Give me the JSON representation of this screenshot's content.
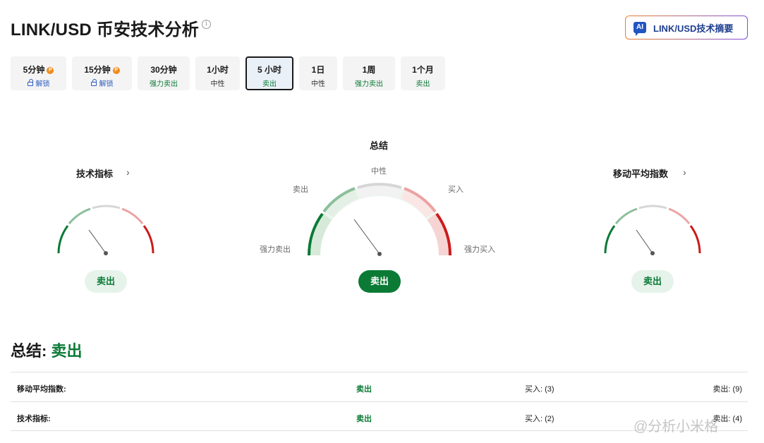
{
  "header": {
    "title": "LINK/USD 币安技术分析",
    "info_icon": "info-icon",
    "ai_badge": "AI",
    "ai_button_label": "LINK/USD技术摘要"
  },
  "tabs": [
    {
      "label": "5分钟",
      "sub": "解锁",
      "locked": true,
      "pro": "P"
    },
    {
      "label": "15分钟",
      "sub": "解锁",
      "locked": true,
      "pro": "P"
    },
    {
      "label": "30分钟",
      "sub": "强力卖出"
    },
    {
      "label": "1小时",
      "sub": "中性"
    },
    {
      "label": "5 小时",
      "sub": "卖出",
      "active": true
    },
    {
      "label": "1日",
      "sub": "中性"
    },
    {
      "label": "1周",
      "sub": "强力卖出"
    },
    {
      "label": "1个月",
      "sub": "卖出"
    }
  ],
  "gauges": {
    "technical": {
      "title": "技术指标",
      "result": "卖出"
    },
    "summary": {
      "title": "总结",
      "result": "卖出",
      "labels": {
        "neutral": "中性",
        "sell": "卖出",
        "buy": "买入",
        "strong_sell": "强力卖出",
        "strong_buy": "强力买入"
      }
    },
    "moving_avg": {
      "title": "移动平均指数",
      "result": "卖出"
    }
  },
  "summary": {
    "label": "总结:",
    "value": "卖出"
  },
  "table": [
    {
      "name": "移动平均指数:",
      "signal": "卖出",
      "buy": "买入: (3)",
      "sell": "卖出: (9)"
    },
    {
      "name": "技术指标:",
      "signal": "卖出",
      "buy": "买入: (2)",
      "sell": "卖出: (4)"
    }
  ],
  "watermark": "@分析小米格",
  "colors": {
    "green": "#0a7a35",
    "red": "#cc1a1a",
    "accent_blue": "#2d5dbf"
  }
}
